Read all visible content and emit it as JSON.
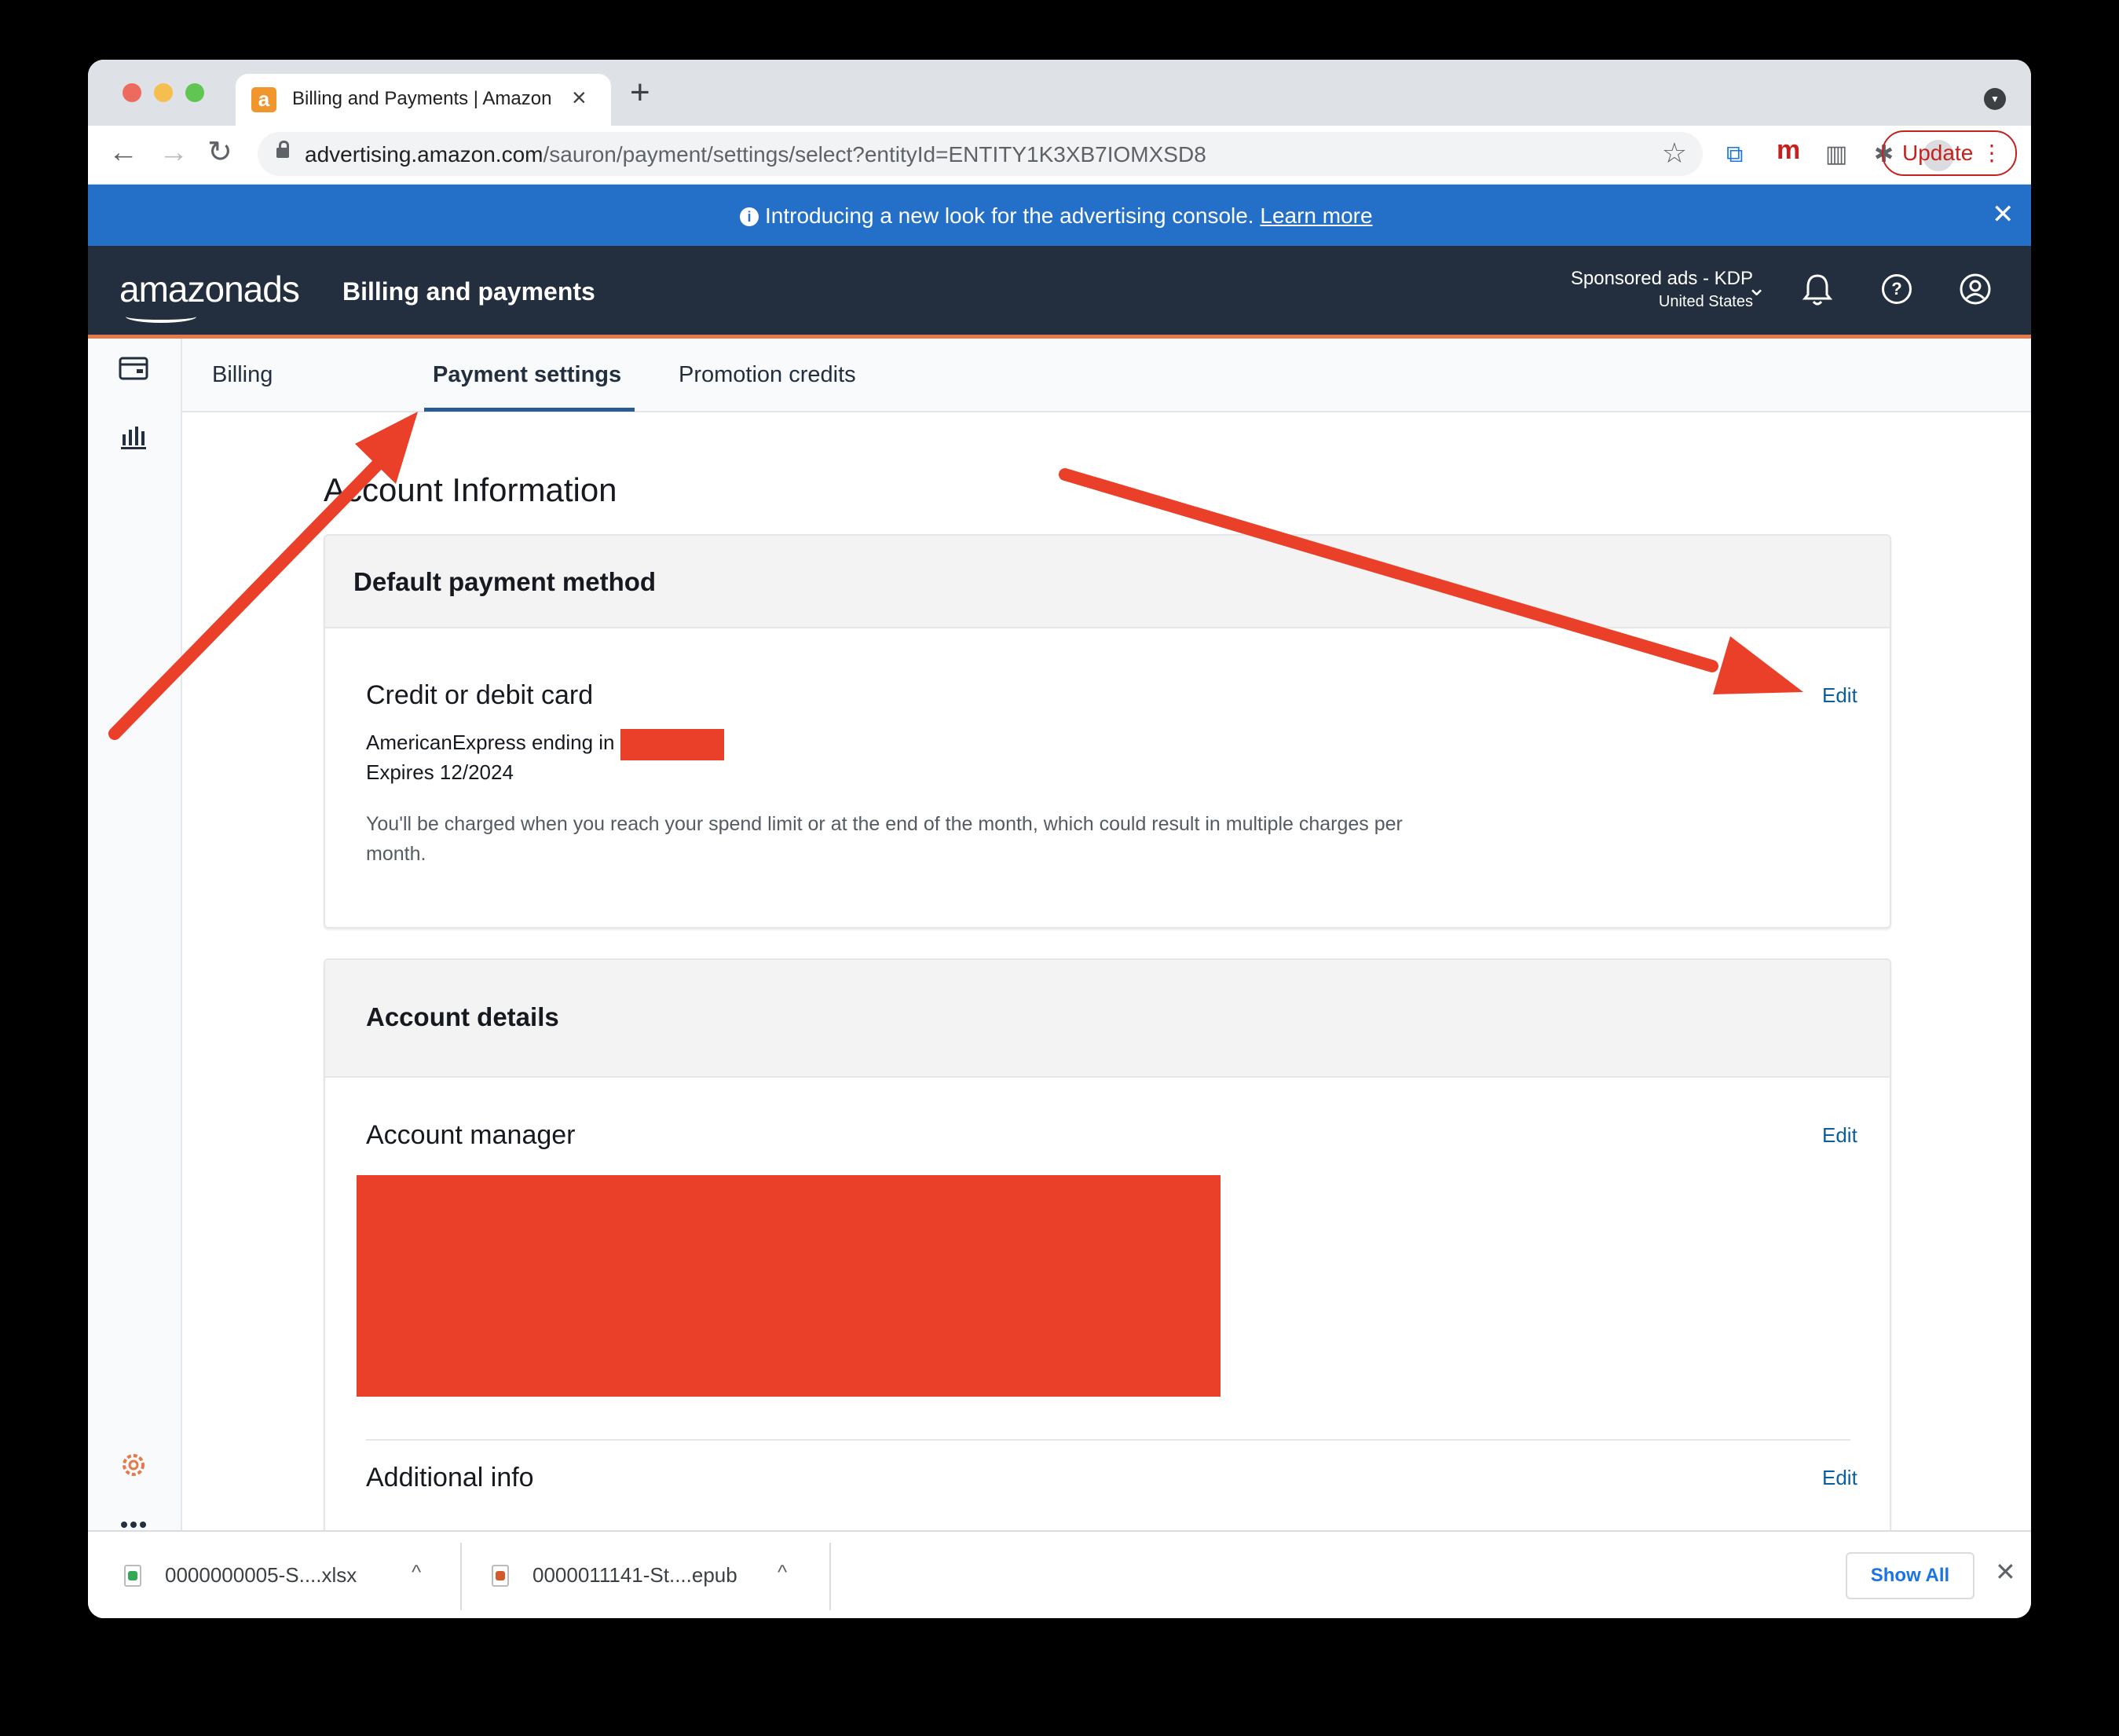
{
  "browser": {
    "tab_title": "Billing and Payments | Amazon",
    "tab_favicon": "a",
    "url_host": "advertising.amazon.com",
    "url_path": "/sauron/payment/settings/select?entityId=ENTITY1K3XB7IOMXSD8",
    "update_label": "Update",
    "extension_letter": "m"
  },
  "banner": {
    "text": "Introducing a new look for the advertising console.",
    "link": "Learn more"
  },
  "header": {
    "logo": "amazonads",
    "title": "Billing and payments",
    "account_name": "Sponsored ads - KDP",
    "account_region": "United States"
  },
  "subnav": {
    "tabs": [
      "Billing",
      "Payment settings",
      "Promotion credits"
    ],
    "active": "Payment settings"
  },
  "content": {
    "section_title": "Account Information",
    "payment_card": {
      "header": "Default payment method",
      "field_title": "Credit or debit card",
      "edit_label": "Edit",
      "card_line": "AmericanExpress ending in",
      "expires": "Expires 12/2024",
      "note": "You'll be charged when you reach your spend limit or at the end of the month, which could result in multiple charges per month."
    },
    "account_card": {
      "header": "Account details",
      "manager_title": "Account manager",
      "manager_edit": "Edit",
      "additional_title": "Additional info",
      "additional_edit": "Edit"
    }
  },
  "downloads": {
    "items": [
      {
        "name": "0000000005-S....xlsx"
      },
      {
        "name": "0000011141-St....epub"
      }
    ],
    "show_all": "Show All"
  },
  "colors": {
    "annotation": "#ea3f29",
    "banner": "#2470c8",
    "header": "#232f3e",
    "link": "#0b5f9e"
  }
}
